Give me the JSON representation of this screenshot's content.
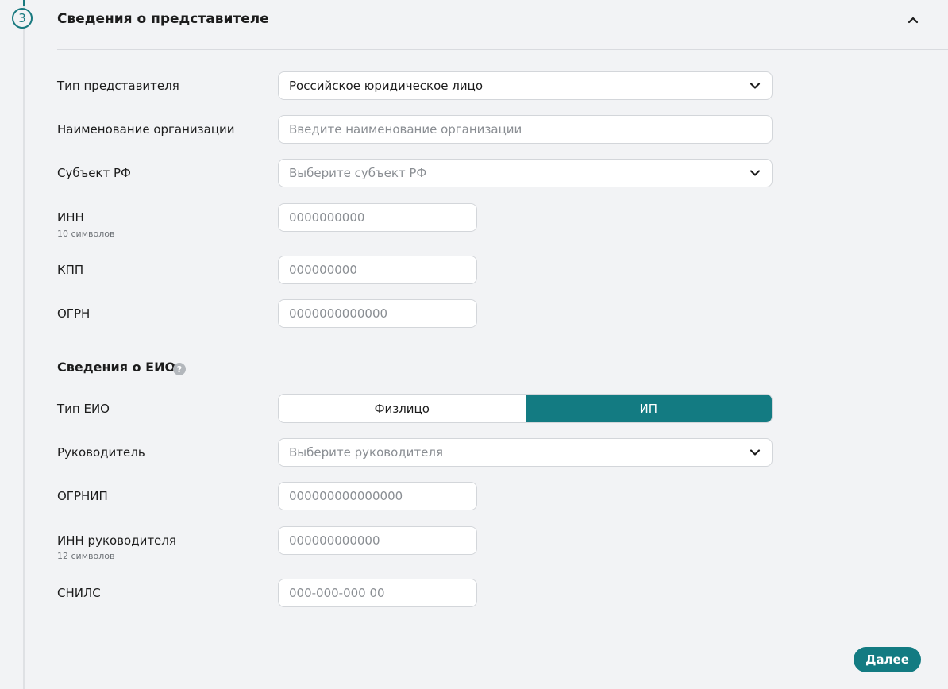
{
  "step": {
    "number": "3",
    "title": "Сведения о представителе"
  },
  "representative": {
    "type": {
      "label": "Тип представителя",
      "value": "Российское юридическое лицо"
    },
    "org_name": {
      "label": "Наименование организации",
      "placeholder": "Введите наименование организации"
    },
    "region": {
      "label": "Субъект РФ",
      "placeholder": "Выберите субъект РФ"
    },
    "inn": {
      "label": "ИНН",
      "hint": "10 символов",
      "placeholder": "0000000000"
    },
    "kpp": {
      "label": "КПП",
      "placeholder": "000000000"
    },
    "ogrn": {
      "label": "ОГРН",
      "placeholder": "0000000000000"
    }
  },
  "eio": {
    "title": "Сведения о ЕИО",
    "help_icon": "question-circle-icon",
    "type": {
      "label": "Тип ЕИО",
      "options": [
        "Физлицо",
        "ИП"
      ],
      "selected": "ИП"
    },
    "head": {
      "label": "Руководитель",
      "placeholder": "Выберите руководителя"
    },
    "ogrnip": {
      "label": "ОГРНИП",
      "placeholder": "000000000000000"
    },
    "head_inn": {
      "label": "ИНН руководителя",
      "hint": "12 символов",
      "placeholder": "000000000000"
    },
    "snils": {
      "label": "СНИЛС",
      "placeholder": "000-000-000 00"
    }
  },
  "actions": {
    "next_label": "Далее"
  },
  "colors": {
    "accent": "#137b82",
    "background": "#f2f3f5",
    "border": "#d3d6da"
  }
}
